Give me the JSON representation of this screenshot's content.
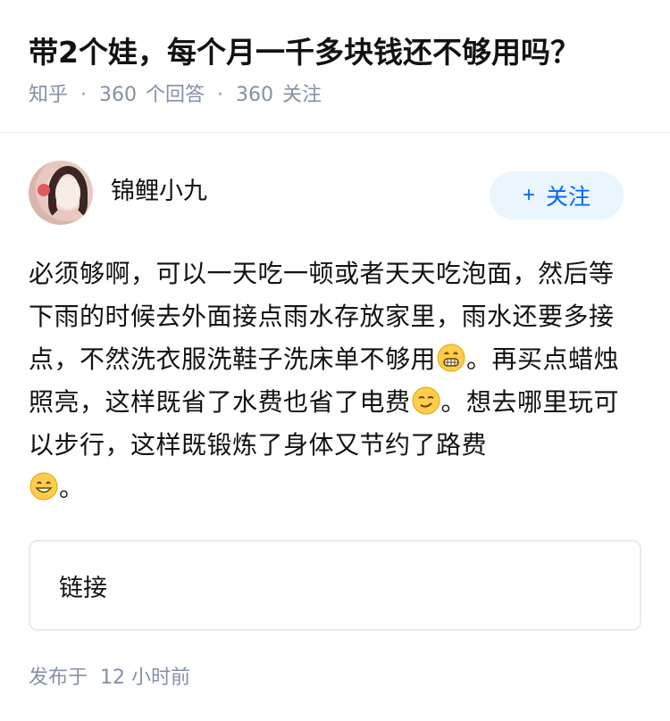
{
  "question": {
    "title": "带2个娃，每个月一千多块钱还不够用吗？",
    "source": "知乎",
    "answer_count": "360",
    "answer_label": "个回答",
    "follower_count": "360",
    "follower_label": "关注"
  },
  "author": {
    "name": "锦鲤小九",
    "follow_label": "关注",
    "follow_icon": "plus-icon"
  },
  "answer": {
    "segment_1": "必须够啊，可以一天吃一顿或者天天吃泡面，然后等下雨的时候去外面接点雨水存放家里，雨水还要多接点，不然洗衣服洗鞋子洗床单不够用",
    "segment_2": "。再买点蜡烛照亮，这样既省了水费也省了电费",
    "segment_3": "。想去哪里玩可以步行，这样既锻炼了身体又节约了路费",
    "segment_4": "。",
    "emojis": [
      "grin-emoji",
      "smirk-emoji",
      "smile-emoji"
    ]
  },
  "link_card": {
    "label": "链接"
  },
  "footer": {
    "published_label": "发布于",
    "published_time": "12 小时前"
  },
  "colors": {
    "accent": "#0066ff",
    "follow_bg": "#ebf5fd",
    "meta_text": "#8590a6"
  }
}
